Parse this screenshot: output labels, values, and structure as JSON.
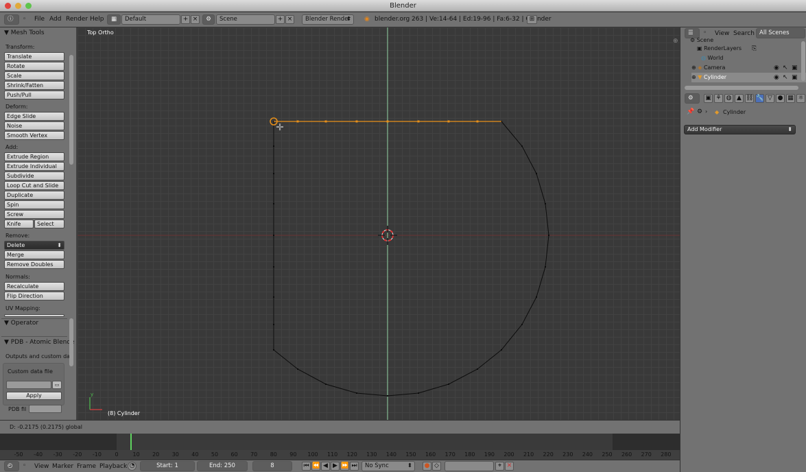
{
  "window": {
    "title": "Blender"
  },
  "infobar": {
    "menus": [
      "File",
      "Add",
      "Render",
      "Help"
    ],
    "screen_layout": "Default",
    "scene": "Scene",
    "render_engine": "Blender Render",
    "stats": "blender.org 263 | Ve:14-64 | Ed:19-96 | Fa:6-32 | Cylinder"
  },
  "toolshelf": {
    "panel_title": "Mesh Tools",
    "transform_label": "Transform:",
    "transform": [
      "Translate",
      "Rotate",
      "Scale",
      "Shrink/Fatten",
      "Push/Pull"
    ],
    "deform_label": "Deform:",
    "deform": [
      "Edge Slide",
      "Noise",
      "Smooth Vertex"
    ],
    "add_label": "Add:",
    "add": [
      "Extrude Region",
      "Extrude Individual",
      "Subdivide",
      "Loop Cut and Slide",
      "Duplicate",
      "Spin",
      "Screw"
    ],
    "knife": "Knife",
    "select": "Select",
    "remove_label": "Remove:",
    "delete": "Delete",
    "remove": [
      "Merge",
      "Remove Doubles"
    ],
    "normals_label": "Normals:",
    "normals": [
      "Recalculate",
      "Flip Direction"
    ],
    "uv_label": "UV Mapping:",
    "operator_title": "Operator",
    "pdb_title": "PDB - Atomic Blende",
    "pdb_desc": "Outputs and custom dat",
    "custom_file_label": "Custom data file",
    "apply_label": "Apply",
    "pdb_field_label": "PDB fil"
  },
  "viewport": {
    "view_name": "Top Ortho",
    "object_label": "(8) Cylinder",
    "axis_y": "y",
    "colors": {
      "selected_edge": "#e8901a",
      "green_axis": "#8fd0a0",
      "red_axis": "#7a3a3a"
    }
  },
  "status": {
    "text": "D: -0.2175 (0.2175) global"
  },
  "timeline": {
    "ticks": [
      "-50",
      "-40",
      "-30",
      "-20",
      "-10",
      "0",
      "10",
      "20",
      "30",
      "40",
      "50",
      "60",
      "70",
      "80",
      "90",
      "100",
      "110",
      "120",
      "130",
      "140",
      "150",
      "160",
      "170",
      "180",
      "190",
      "200",
      "210",
      "220",
      "230",
      "240",
      "250",
      "260",
      "270",
      "280"
    ],
    "current_frame": 8
  },
  "footer": {
    "menus": [
      "View",
      "Marker",
      "Frame",
      "Playback"
    ],
    "start": "Start: 1",
    "end": "End: 250",
    "frame": "8",
    "sync": "No Sync"
  },
  "outliner": {
    "menus": [
      "View",
      "Search"
    ],
    "filter": "All Scenes",
    "items": [
      "Scene",
      "RenderLayers",
      "World",
      "Camera",
      "Cylinder"
    ]
  },
  "properties": {
    "breadcrumb": "Cylinder",
    "add_modifier": "Add Modifier"
  }
}
